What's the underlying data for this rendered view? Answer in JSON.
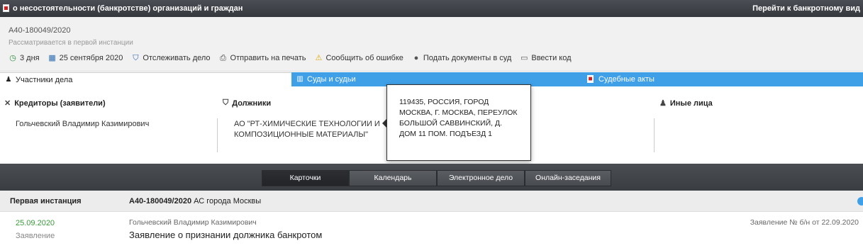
{
  "topbar": {
    "title": "о несостоятельности (банкротстве) организаций и граждан",
    "goto_label": "Перейти к банкротному вид"
  },
  "case": {
    "number": "А40-180049/2020",
    "status": "Рассматривается в первой инстанции"
  },
  "actions": [
    {
      "icon": "clock-icon",
      "label": "3 дня"
    },
    {
      "icon": "calendar-icon",
      "label": "25 сентября 2020"
    },
    {
      "icon": "shield-icon",
      "label": "Отслеживать дело"
    },
    {
      "icon": "printer-icon",
      "label": "Отправить на печать"
    },
    {
      "icon": "warning-icon",
      "label": "Сообщить об ошибке"
    },
    {
      "icon": "submit-icon",
      "label": "Подать документы в суд"
    },
    {
      "icon": "keyboard-icon",
      "label": "Ввести код"
    }
  ],
  "tabs": {
    "participants": "Участники дела",
    "courts": "Суды и судьи",
    "acts": "Судебные акты"
  },
  "participants": {
    "creditors_header": "Кредиторы (заявители)",
    "creditor_name": "Гольчевский Владимир Казимирович",
    "debtors_header": "Должники",
    "debtor_name": "АО \"РТ-ХИМИЧЕСКИЕ ТЕХНОЛОГИИ И КОМПОЗИЦИОННЫЕ МАТЕРИАЛЫ\"",
    "others_header": "Иные лица"
  },
  "tooltip": {
    "address": "119435, РОССИЯ, ГОРОД МОСКВА, Г. МОСКВА, ПЕРЕУЛОК БОЛЬШОЙ САВВИНСКИЙ, Д. ДОМ 11 ПОМ. ПОДЪЕЗД 1"
  },
  "nav": {
    "cards": "Карточки",
    "calendar": "Календарь",
    "electronic_case": "Электронное дело",
    "online_sessions": "Онлайн-заседания"
  },
  "instance": {
    "label": "Первая инстанция",
    "case_number": "А40-180049/2020",
    "court": "АС города Москвы"
  },
  "document": {
    "date": "25.09.2020",
    "type": "Заявление",
    "author": "Гольчевский Владимир Казимирович",
    "title": "Заявление о признании должника банкротом",
    "ref": "Заявление № б/н от 22.09.2020"
  }
}
